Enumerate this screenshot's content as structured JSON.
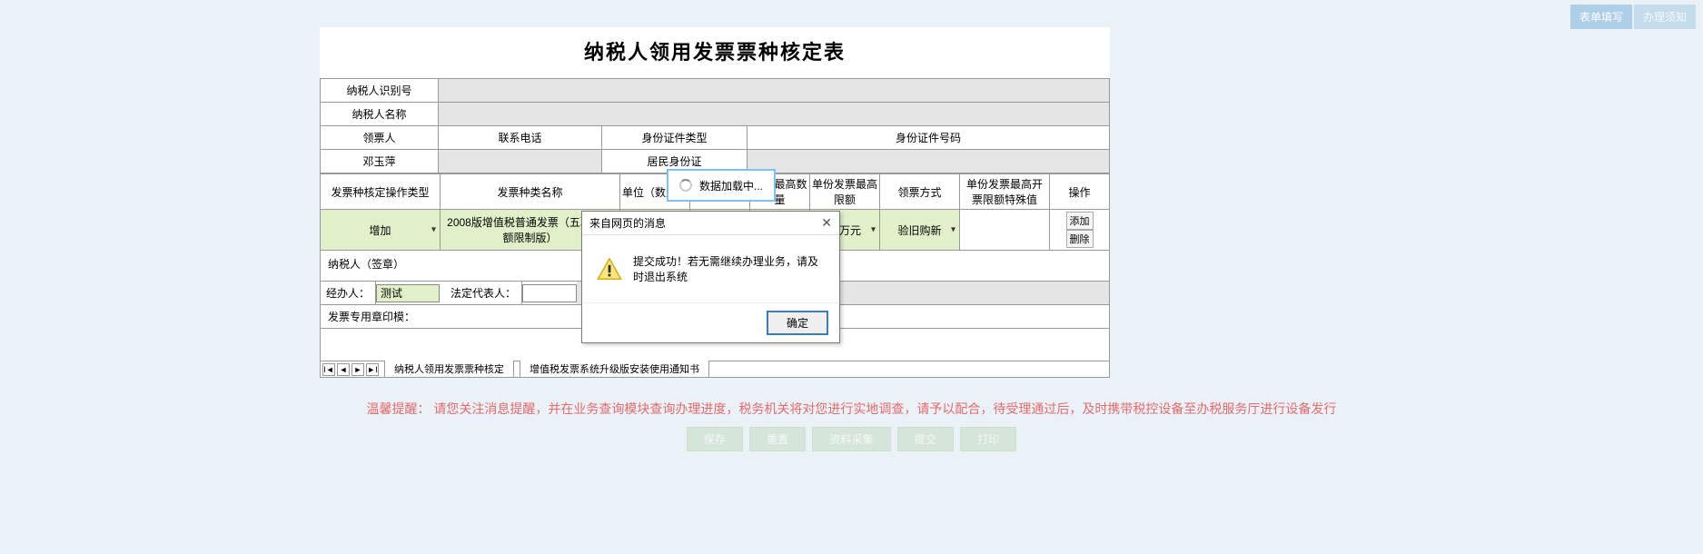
{
  "header": {
    "btn_form_fill": "表单填写",
    "btn_notice": "办理须知"
  },
  "form": {
    "title": "纳税人领用发票票种核定表",
    "labels": {
      "taxpayer_id": "纳税人识别号",
      "taxpayer_name": "纳税人名称",
      "receiver": "领票人",
      "phone": "联系电话",
      "id_type": "身份证件类型",
      "id_no": "身份证件号码",
      "operation_type": "发票种核定操作类型",
      "invoice_kind": "发票种类名称",
      "unit_qty": "单位（数量）",
      "max_hold": "持票最高数量",
      "unit_max_limit": "单份发票最高限额",
      "receive_method": "领票方式",
      "unit_max_special": "单份发票最高开票限额特殊值",
      "operation": "操作",
      "signature": "纳税人（签章）",
      "handler": "经办人：",
      "legal_rep": "法定代表人：",
      "seal": "发票专用章印模："
    },
    "values": {
      "taxpayer_id": "",
      "taxpayer_name": "",
      "receiver": "邓玉萍",
      "phone": "",
      "id_type": "居民身份证",
      "id_no": "",
      "operation_type": "增加",
      "invoice_kind": "2008版增值税普通发票（五联无金额限制版）",
      "unit_max_limit": "十万元",
      "receive_method": "验旧购新",
      "handler_input": "测试",
      "legal_rep_input": ""
    },
    "op_buttons": {
      "add": "添加",
      "delete": "删除"
    },
    "sheet_tabs": {
      "tab1": "纳税人领用发票票种核定",
      "tab2": "增值税发票系统升级版安装使用通知书"
    }
  },
  "loading": {
    "text": "数据加载中..."
  },
  "dialog": {
    "title": "来自网页的消息",
    "message": "提交成功！若无需继续办理业务，请及时退出系统",
    "ok": "确定"
  },
  "tip": "温馨提醒：  请您关注消息提醒，并在业务查询模块查询办理进度，税务机关将对您进行实地调查，请予以配合，待受理通过后，及时携带税控设备至办税服务厅进行设备发行",
  "bottom_buttons": {
    "save": "保存",
    "reset": "重置",
    "materials": "资料采集",
    "submit": "提交",
    "print": "打印"
  }
}
